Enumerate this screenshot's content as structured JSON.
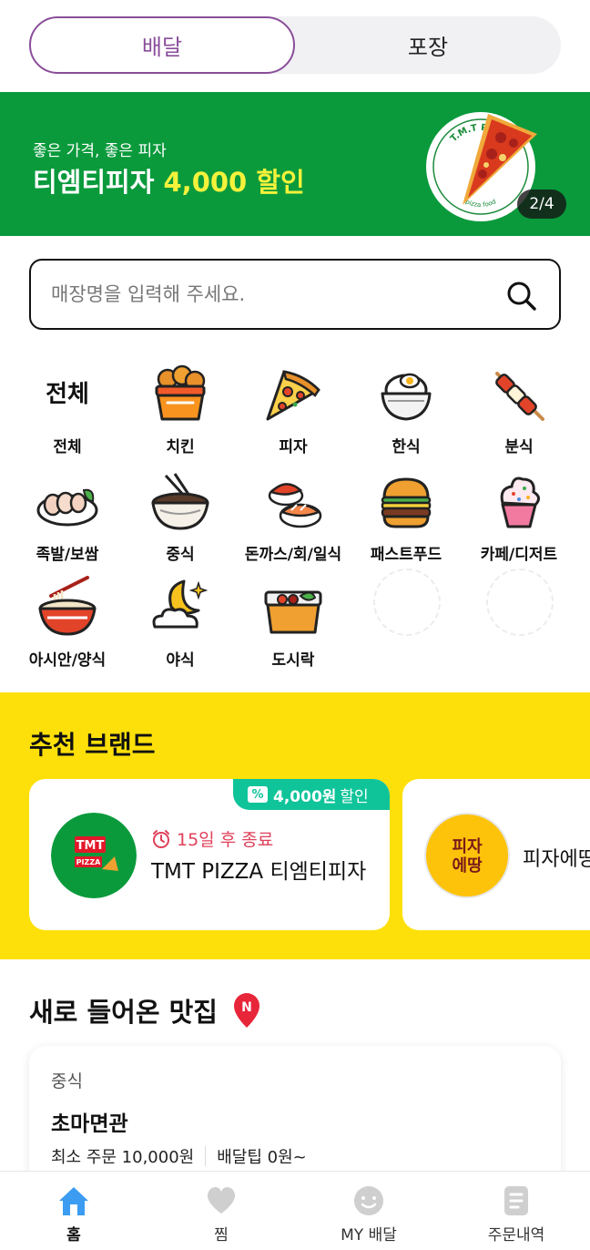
{
  "toggle": {
    "delivery": "배달",
    "takeout": "포장",
    "selected": "delivery"
  },
  "banner": {
    "subtitle": "좋은 가격, 좋은 피자",
    "title_main": "티엠티피자 ",
    "title_highlight": "4,000 할인",
    "plate_text": "T.M.T PIZZA",
    "plate_text_bottom": "pizza food",
    "counter": "2/4",
    "background_color": "#0a9a3c",
    "highlight_color": "#f5f23b"
  },
  "search": {
    "placeholder": "매장명을 입력해 주세요."
  },
  "categories": [
    {
      "label": "전체",
      "icon_text": "전체",
      "icon": "all-text-icon"
    },
    {
      "label": "치킨",
      "icon": "fried-chicken-icon"
    },
    {
      "label": "피자",
      "icon": "pizza-slice-icon"
    },
    {
      "label": "한식",
      "icon": "rice-bowl-icon"
    },
    {
      "label": "분식",
      "icon": "skewer-icon"
    },
    {
      "label": "족발/보쌈",
      "icon": "jokbal-plate-icon"
    },
    {
      "label": "중식",
      "icon": "noodle-bowl-icon"
    },
    {
      "label": "돈까스/회/일식",
      "icon": "sushi-icon"
    },
    {
      "label": "패스트푸드",
      "icon": "burger-icon"
    },
    {
      "label": "카페/디저트",
      "icon": "cupcake-icon"
    },
    {
      "label": "아시안/양식",
      "icon": "pho-bowl-icon"
    },
    {
      "label": "야식",
      "icon": "moon-cloud-icon"
    },
    {
      "label": "도시락",
      "icon": "lunchbox-icon"
    }
  ],
  "recommended": {
    "title": "추천 브랜드",
    "background_color": "#fde00a",
    "brands": [
      {
        "badge_icon": "%",
        "discount": "4,000원",
        "discount_suffix": "할인",
        "timer": "15일 후 종료",
        "name": "TMT PIZZA 티엠티피자",
        "logo_text": "TMT",
        "logo_sub": "PIZZA"
      },
      {
        "name": "피자에땅",
        "logo_line1": "피자",
        "logo_line2": "에땅"
      }
    ]
  },
  "new_restaurants": {
    "title": "새로 들어온 맛집",
    "badge": "N",
    "items": [
      {
        "category": "중식",
        "name": "초마면관",
        "min_order": "최소 주문 10,000원",
        "delivery_tip": "배달팁 0원~"
      }
    ]
  },
  "bottom_nav": [
    {
      "label": "홈",
      "icon": "home-icon",
      "active": true
    },
    {
      "label": "찜",
      "icon": "heart-icon",
      "active": false
    },
    {
      "label": "MY 배달",
      "icon": "smile-face-icon",
      "active": false
    },
    {
      "label": "주문내역",
      "icon": "order-list-icon",
      "active": false
    }
  ],
  "accent_color": "#8a4e9a"
}
